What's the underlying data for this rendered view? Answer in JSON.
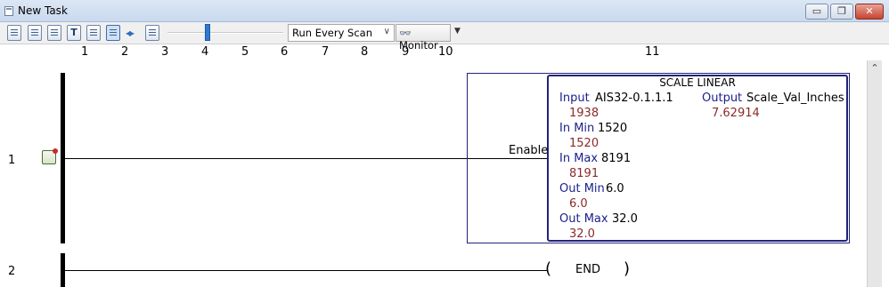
{
  "window": {
    "title": "New Task",
    "buttons": {
      "minimize": "▭",
      "maximize": "❐",
      "close": "✕"
    }
  },
  "toolbar": {
    "icons": [
      "page-icon",
      "rung-list-icon",
      "branch-icon",
      "text-icon",
      "list-icon",
      "selected-view-icon",
      "arrows-icon",
      "network-icon"
    ],
    "text_button": "T",
    "arrows": "◂▸",
    "scan_mode": "Run Every Scan",
    "monitor_label": "Monitor",
    "monitor_icon": "eyeglasses-icon"
  },
  "ruler": {
    "columns": [
      "1",
      "2",
      "3",
      "4",
      "5",
      "6",
      "7",
      "8",
      "9",
      "10",
      "11"
    ]
  },
  "rungs": [
    {
      "number": "1",
      "block": {
        "title": "SCALE LINEAR",
        "enable_label": "Enable",
        "params": [
          {
            "label": "Input",
            "value": "AIS32-0.1.1.1",
            "live": "1938"
          },
          {
            "label": "In Min",
            "value": "1520",
            "live": "1520"
          },
          {
            "label": "In Max",
            "value": "8191",
            "live": "8191"
          },
          {
            "label": "Out Min",
            "value": "6.0",
            "live": "6.0"
          },
          {
            "label": "Out Max",
            "value": "32.0",
            "live": "32.0"
          }
        ],
        "output": {
          "label": "Output",
          "value": "Scale_Val_Inches",
          "live": "7.62914"
        }
      }
    },
    {
      "number": "2",
      "coil": {
        "open": "(",
        "label": "END",
        "close": ")"
      }
    }
  ],
  "colors": {
    "label_blue": "#1a1f8c",
    "live_red": "#8b2a2a",
    "block_border": "#23237a",
    "slider": "#2f7ad0"
  }
}
